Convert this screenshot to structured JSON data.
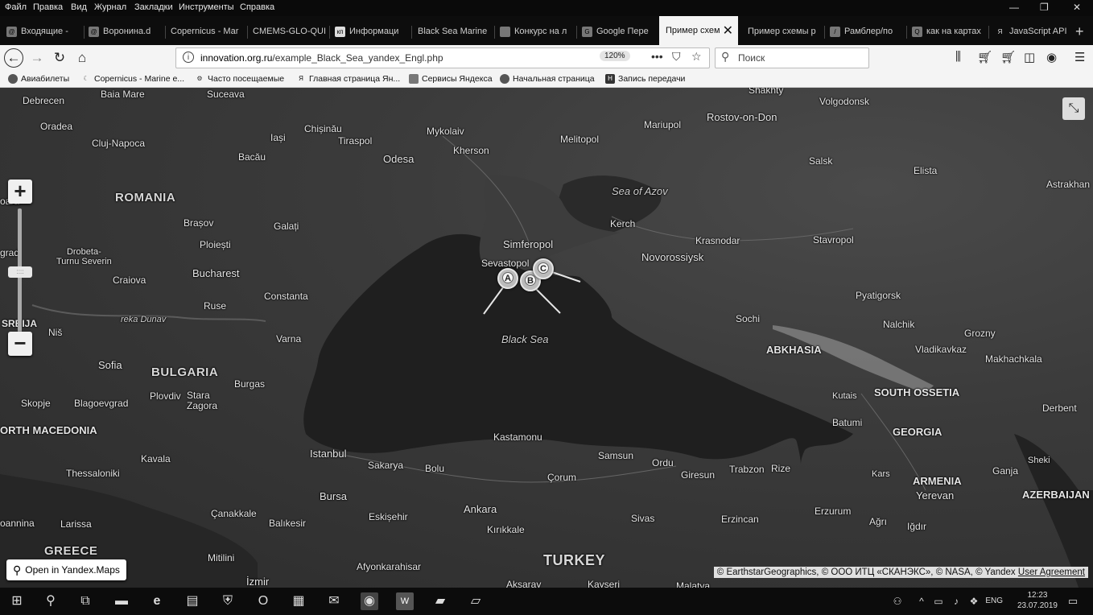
{
  "menu": [
    "Файл",
    "Правка",
    "Вид",
    "Журнал",
    "Закладки",
    "Инструменты",
    "Справка"
  ],
  "tabs": [
    {
      "label": "Входящие -",
      "icon": "mail-icon"
    },
    {
      "label": "Воронина.d",
      "icon": "mail-icon"
    },
    {
      "label": "Copernicus - Mar",
      "icon": ""
    },
    {
      "label": "CMEMS-GLO-QUI",
      "icon": ""
    },
    {
      "label": "Информаци",
      "icon": "kp-icon"
    },
    {
      "label": "Black Sea Marine",
      "icon": ""
    },
    {
      "label": "Конкурс на л",
      "icon": "doc-icon"
    },
    {
      "label": "Google Пере",
      "icon": "translate-icon"
    },
    {
      "label": "Пример схем",
      "icon": "",
      "active": true
    },
    {
      "label": "Пример схемы р",
      "icon": ""
    },
    {
      "label": "Рамблер/по",
      "icon": "rambler-icon"
    },
    {
      "label": "как на картах",
      "icon": "search-icon"
    },
    {
      "label": "JavaScript API",
      "icon": "yandex-icon"
    }
  ],
  "url": {
    "host": "innovation.org.ru",
    "path": "/example_Black_Sea_yandex_Engl.php",
    "zoom": "120%"
  },
  "search": {
    "placeholder": "Поиск"
  },
  "bookmarks": [
    {
      "label": "Авиабилеты",
      "icon": "globe-icon"
    },
    {
      "label": "Copernicus - Marine e...",
      "icon": "moon-icon"
    },
    {
      "label": "Часто посещаемые",
      "icon": "gear-icon"
    },
    {
      "label": "Главная страница Ян...",
      "icon": "yandex-icon"
    },
    {
      "label": "Сервисы Яндекса",
      "icon": "folder-icon"
    },
    {
      "label": "Начальная страница",
      "icon": "firefox-icon"
    },
    {
      "label": "Запись передачи",
      "icon": "h-icon"
    }
  ],
  "map": {
    "labels": {
      "debrecen": "Debrecen",
      "baia_mare": "Baia Mare",
      "suceava": "Suceava",
      "oradea": "Oradea",
      "cluj": "Cluj-Napoca",
      "chisinau": "Chișinău",
      "iasi": "Iași",
      "tiraspol": "Tiraspol",
      "bacau": "Bacău",
      "odesa": "Odesa",
      "mykolaiv": "Mykolaiv",
      "kherson": "Kherson",
      "melitopol": "Melitopol",
      "mariupol": "Mariupol",
      "rostov": "Rostov-on-Don",
      "volgodonsk": "Volgodonsk",
      "shakhty": "Shakhty",
      "salsk": "Salsk",
      "elista": "Elista",
      "astrakhan": "Astrakhan",
      "romania": "ROMANIA",
      "timisoara": "oara",
      "brasov": "Brașov",
      "galati": "Galați",
      "ploiesti": "Ploiești",
      "drobeta": "Drobeta-\nTurnu Severin",
      "grad": "grad",
      "bucharest": "Bucharest",
      "craiova": "Craiova",
      "constanta": "Constanta",
      "ruse": "Ruse",
      "dunav": "reka Dunav",
      "srbija": "SRBIJA",
      "nis": "Niš",
      "varna": "Varna",
      "sofia": "Sofia",
      "bulgaria": "BULGARIA",
      "burgas": "Burgas",
      "plovdiv": "Plovdiv",
      "stara": "Stara\nZagora",
      "skopje": "Skopje",
      "blagoevgrad": "Blagoevgrad",
      "macedonia": "ORTH MACEDONIA",
      "kavala": "Kavala",
      "thessaloniki": "Thessaloniki",
      "istanbul": "Istanbul",
      "sakarya": "Sakarya",
      "bolu": "Bolu",
      "kastamonu": "Kastamonu",
      "samsun": "Samsun",
      "ordu": "Ordu",
      "giresun": "Giresun",
      "trabzon": "Trabzon",
      "rize": "Rize",
      "corum": "Çorum",
      "bursa": "Bursa",
      "eskisehir": "Eskișehir",
      "ankara": "Ankara",
      "kirikkale": "Kırıkkale",
      "sivas": "Sivas",
      "erzincan": "Erzincan",
      "erzurum": "Erzurum",
      "agri": "Ağrı",
      "igdir": "Iğdır",
      "canakkale": "Çanakkale",
      "balikesir": "Balıkesir",
      "larissa": "Larissa",
      "annina": "oannina",
      "greece": "GREECE",
      "mitilini": "Mitilini",
      "izmir": "İzmir",
      "afyon": "Afyonkarahisar",
      "turkey": "TURKEY",
      "aksaray": "Aksaray",
      "kayseri": "Kayseri",
      "malatya": "Malatya",
      "sea_azov": "Sea of Azov",
      "kerch": "Kerch",
      "krasnodar": "Krasnodar",
      "stavropol": "Stavropol",
      "simferopol": "Simferopol",
      "sevastopol": "Sevastopol",
      "novorossiysk": "Novorossiysk",
      "pyatigorsk": "Pyatigorsk",
      "black_sea": "Black Sea",
      "sochi": "Sochi",
      "nalchik": "Nalchik",
      "grozny": "Grozny",
      "abkhasia": "ABKHASIA",
      "vladikavkaz": "Vladikavkaz",
      "makhachkala": "Makhachkala",
      "south_ossetia": "SOUTH OSSETIA",
      "kutais": "Kutais",
      "derbent": "Derbent",
      "batumi": "Batumi",
      "georgia": "GEORGIA",
      "sheki": "Sheki",
      "ganja": "Ganja",
      "kars": "Kars",
      "armenia": "ARMENIA",
      "yerevan": "Yerevan",
      "azerbaijan": "AZERBAIJAN"
    },
    "markers": [
      "A",
      "B",
      "C"
    ],
    "open_button": "Open in Yandex.Maps",
    "copyright": "© EarthstarGeographics, © ООО ИТЦ «СКАНЭКС», © NASA, © Yandex",
    "user_agreement": "User Agreement"
  },
  "taskbar": {
    "lang": "ENG",
    "time": "12:23",
    "date": "23.07.2019"
  }
}
